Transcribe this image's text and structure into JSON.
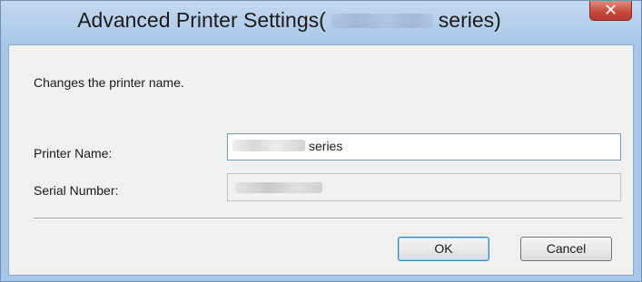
{
  "window": {
    "title_prefix": "Advanced Printer Settings(",
    "title_suffix": "series)",
    "close_glyph": "✕"
  },
  "content": {
    "description": "Changes the printer name.",
    "printer_name_label": "Printer Name:",
    "printer_name_value_suffix": "series",
    "serial_number_label": "Serial Number:"
  },
  "buttons": {
    "ok_label": "OK",
    "cancel_label": "Cancel"
  },
  "colors": {
    "titlebar": "#a9c6e8",
    "close_button": "#c7483a",
    "dialog_body": "#f0f0f0"
  }
}
